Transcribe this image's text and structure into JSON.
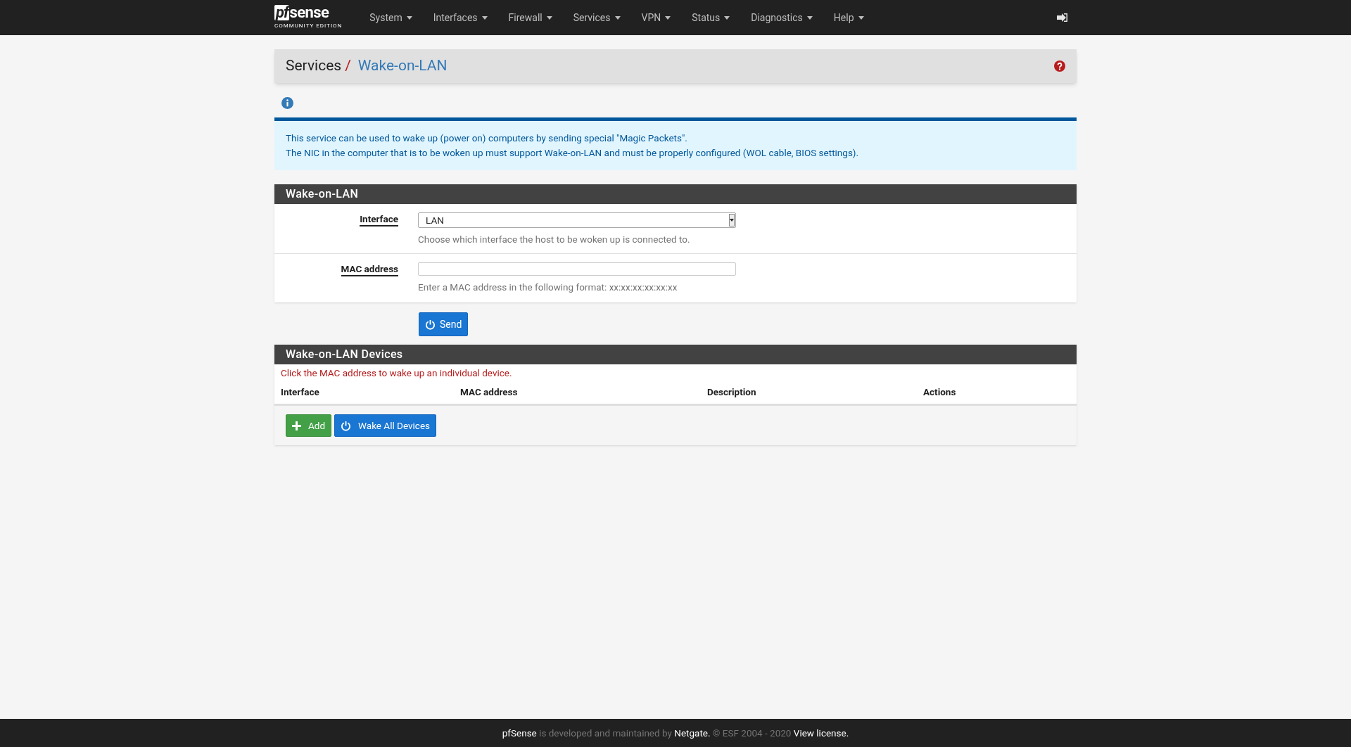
{
  "navbar": {
    "logo": {
      "mark": "pf",
      "word": "sense",
      "edition": "COMMUNITY EDITION"
    },
    "menus": [
      "System",
      "Interfaces",
      "Firewall",
      "Services",
      "VPN",
      "Status",
      "Diagnostics",
      "Help"
    ]
  },
  "breadcrumb": {
    "parent": "Services",
    "separator": "/",
    "current": "Wake-on-LAN"
  },
  "info_alert": {
    "lines": [
      "This service can be used to wake up (power on) computers by sending special \"Magic Packets\".",
      "The NIC in the computer that is to be woken up must support Wake-on-LAN and must be properly configured (WOL cable, BIOS settings)."
    ]
  },
  "form_panel": {
    "title": "Wake-on-LAN",
    "fields": [
      {
        "kind": "select",
        "label": "Interface",
        "value": "LAN",
        "help": "Choose which interface the host to be woken up is connected to."
      },
      {
        "kind": "text",
        "label": "MAC address",
        "help": "Enter a MAC address in the following format: xx:xx:xx:xx:xx:xx"
      }
    ],
    "send_button": "Send"
  },
  "devices_panel": {
    "title": "Wake-on-LAN Devices",
    "note": "Click the MAC address to wake up an individual device.",
    "columns": [
      "Interface",
      "MAC address",
      "Description",
      "Actions"
    ],
    "buttons": [
      {
        "kind": "add",
        "label": "Add"
      },
      {
        "kind": "wake",
        "label": "Wake All Devices"
      }
    ]
  },
  "footer": [
    {
      "kind": "link",
      "text": "pfSense"
    },
    {
      "kind": "text",
      "text": " is developed and maintained by "
    },
    {
      "kind": "link",
      "text": "Netgate."
    },
    {
      "kind": "text",
      "text": " © ESF 2004 - 2020 "
    },
    {
      "kind": "link",
      "text": "View license."
    }
  ]
}
